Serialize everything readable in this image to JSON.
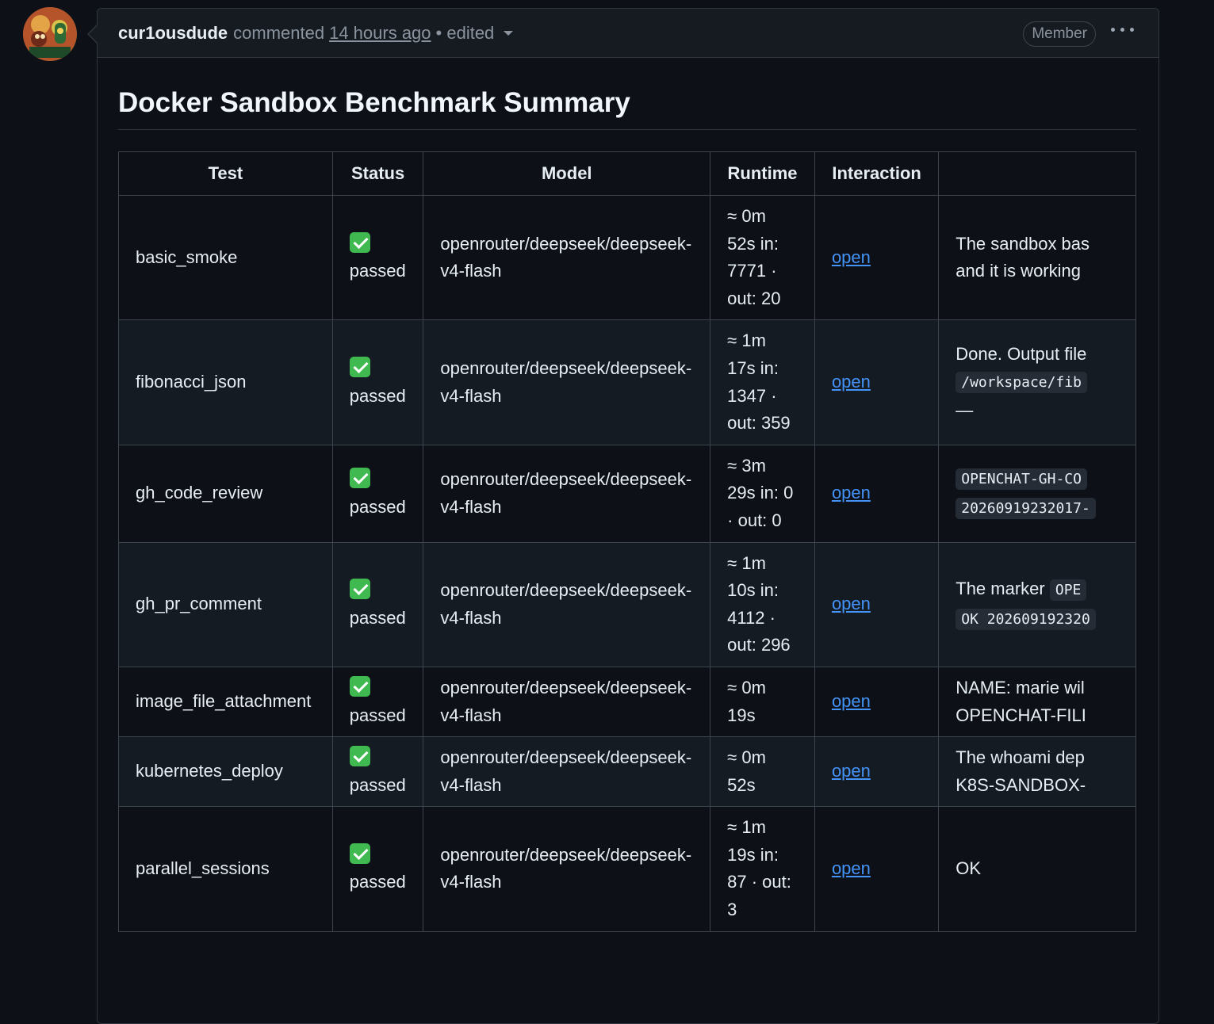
{
  "comment": {
    "author": "cur1ousdude",
    "action": "commented",
    "timestamp": "14 hours ago",
    "edited": "• edited",
    "badge": "Member"
  },
  "document": {
    "title": "Docker Sandbox Benchmark Summary"
  },
  "table": {
    "headers": [
      "Test",
      "Status",
      "Model",
      "Runtime",
      "Interaction",
      ""
    ],
    "rows": [
      {
        "test": "basic_smoke",
        "status": "passed",
        "model": "openrouter/deepseek/deepseek-v4-flash",
        "runtime": "≈ 0m 52s",
        "tokens": "in: 7771 · out: 20",
        "interaction": "open",
        "output_line1": "The sandbox bas",
        "output_line2": "and it is working"
      },
      {
        "test": "fibonacci_json",
        "status": "passed",
        "model": "openrouter/deepseek/deepseek-v4-flash",
        "runtime": "≈ 1m 17s",
        "tokens": "in: 1347 · out: 359",
        "interaction": "open",
        "output_line1": "Done. Output file",
        "output_code1": "/workspace/fib",
        "output_line3": "—"
      },
      {
        "test": "gh_code_review",
        "status": "passed",
        "model": "openrouter/deepseek/deepseek-v4-flash",
        "runtime": "≈ 3m 29s",
        "tokens": "in: 0 · out: 0",
        "interaction": "open",
        "output_code1": "OPENCHAT-GH-CO",
        "output_code2": "20260919232017-"
      },
      {
        "test": "gh_pr_comment",
        "status": "passed",
        "model": "openrouter/deepseek/deepseek-v4-flash",
        "runtime": "≈ 1m 10s",
        "tokens": "in: 4112 · out: 296",
        "interaction": "open",
        "output_line1": "The marker",
        "output_code1": "OPE",
        "output_code2": "OK 202609192320"
      },
      {
        "test": "image_file_attachment",
        "status": "passed",
        "model": "openrouter/deepseek/deepseek-v4-flash",
        "runtime": "≈ 0m 19s",
        "interaction": "open",
        "output_line1": "NAME: marie wil",
        "output_line2": "OPENCHAT-FILI"
      },
      {
        "test": "kubernetes_deploy",
        "status": "passed",
        "model": "openrouter/deepseek/deepseek-v4-flash",
        "runtime": "≈ 0m 52s",
        "interaction": "open",
        "output_line1": "The whoami dep",
        "output_line2": "K8S-SANDBOX-"
      },
      {
        "test": "parallel_sessions",
        "status": "passed",
        "model": "openrouter/deepseek/deepseek-v4-flash",
        "runtime": "≈ 1m 19s",
        "tokens": "in: 87 · out: 3",
        "interaction": "open",
        "output_line1": "OK"
      }
    ]
  },
  "colors": {
    "background": "#0d1117",
    "header_bg": "#161b22",
    "border": "#30363d",
    "link": "#4493f8",
    "check": "#3fb950"
  }
}
